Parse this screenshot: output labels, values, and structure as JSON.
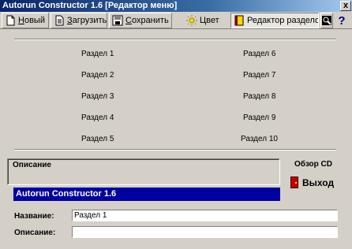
{
  "window": {
    "title": "Autorun Constructor 1.6 [Редактор меню]",
    "close_glyph": "x"
  },
  "toolbar": {
    "new_label_accel": "Н",
    "new_label_rest": "овый",
    "load_label_accel": "З",
    "load_label_rest": "агрузить",
    "save_label_accel": "С",
    "save_label_rest": "охранить",
    "color_label": "Цвет",
    "editor_label": "Редактор разделов",
    "help_glyph": "?"
  },
  "menu": {
    "left": [
      "Раздел 1",
      "Раздел 2",
      "Раздел 3",
      "Раздел 4",
      "Раздел 5"
    ],
    "right": [
      "Раздел 6",
      "Раздел 7",
      "Раздел 8",
      "Раздел 9",
      "Раздел 10"
    ]
  },
  "description_box": {
    "label": "Описание"
  },
  "status": {
    "text": "Autorun Constructor 1.6"
  },
  "side": {
    "cd_label": "Обзор CD",
    "exit_label": "Выход"
  },
  "form": {
    "name_label": "Название:",
    "name_value": "Раздел 1",
    "desc_label": "Описание:",
    "desc_value": ""
  },
  "colors": {
    "title_start": "#0a246a",
    "status_bg": "#0000a0",
    "face": "#d4d0c8",
    "exit_icon": "#c00000"
  }
}
